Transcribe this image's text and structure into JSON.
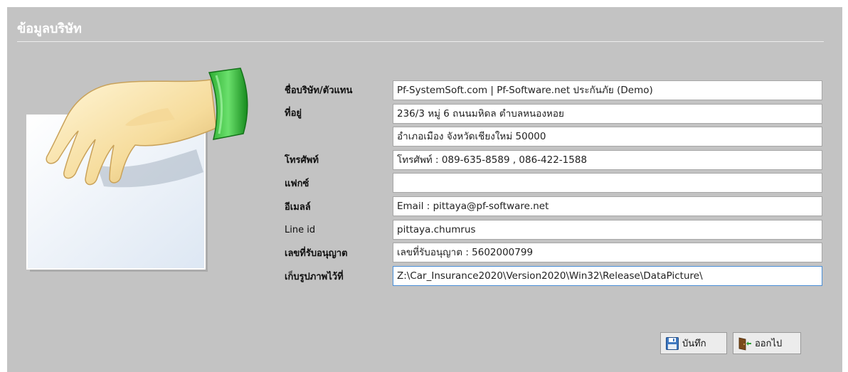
{
  "window": {
    "title": "ข้อมูลบริษัท"
  },
  "form": {
    "labels": {
      "company": "ชื่อบริษัท/ตัวแทน",
      "address": "ที่อยู่",
      "phone": "โทรศัพท์",
      "fax": "แฟกซ์",
      "email": "อีเมลล์",
      "line": "Line id",
      "license": "เลขที่รับอนุญาต",
      "picture_path": "เก็บรูปภาพไว้ที่"
    },
    "values": {
      "company": "Pf-SystemSoft.com | Pf-Software.net ประกันภัย (Demo)",
      "address1": "236/3 หมู่ 6 ถนนมหิดล ตำบลหนองหอย",
      "address2": "อำเภอเมือง จังหวัดเชียงใหม่ 50000",
      "phone": "โทรศัพท์ : 089-635-8589 , 086-422-1588",
      "fax": "",
      "email": "Email : pittaya@pf-software.net",
      "line": "pittaya.chumrus",
      "license": "เลขที่รับอนุญาต : 5602000799",
      "picture_path": "Z:\\Car_Insurance2020\\Version2020\\Win32\\Release\\DataPicture\\"
    }
  },
  "buttons": {
    "save": "บันทึก",
    "exit": "ออกไป"
  },
  "icons": {
    "illustration": "hand-holding-paper-icon",
    "save": "floppy-disk-icon",
    "exit": "exit-door-icon"
  },
  "colors": {
    "panel": "#c3c3c3",
    "wristband": "#36c43c",
    "focus_border": "#4a8fd8"
  }
}
